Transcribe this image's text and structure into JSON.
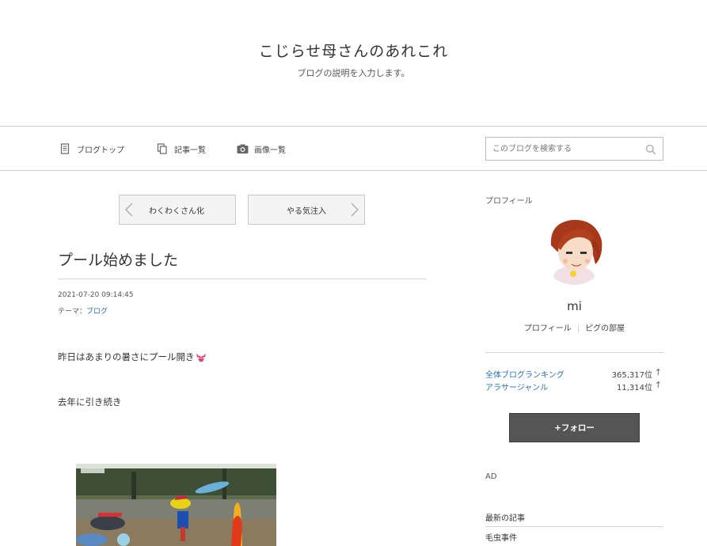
{
  "blog": {
    "title": "こじらせ母さんのあれこれ",
    "description": "ブログの説明を入力します。"
  },
  "nav": {
    "top_label": "ブログトップ",
    "top_icon": "document-icon",
    "list_label": "記事一覧",
    "list_icon": "copy-icon",
    "images_label": "画像一覧",
    "images_icon": "camera-icon"
  },
  "search": {
    "placeholder": "このブログを検索する",
    "value": "",
    "icon": "search-icon"
  },
  "pager": {
    "prev_label": "わくわくさん化",
    "next_label": "やる気注入"
  },
  "entry": {
    "title": "プール始めました",
    "date": "2021-07-20 09:14:45",
    "theme_prefix": "テーマ：",
    "theme": "ブログ",
    "paragraph1": "昨日はあまりの暑さにプール開き",
    "paragraph1_emoji": "bikini-icon",
    "paragraph2": "去年に引き続き"
  },
  "sidebar": {
    "profile_label": "プロフィール",
    "name": "mi",
    "profile_link": "プロフィール",
    "room_link": "ピグの部屋",
    "rankings": [
      {
        "name": "全体ブログランキング",
        "value": "365,317位",
        "arrow": "↑"
      },
      {
        "name": "アラサージャンル",
        "value": "11,314位",
        "arrow": "↑"
      }
    ],
    "follow_label": "+フォロー",
    "ad_label": "AD",
    "latest_label": "最新の記事",
    "latest_items": [
      "毛虫事件"
    ]
  },
  "colors": {
    "link": "#2a6fb8",
    "follow_bg": "#555555",
    "border": "#cfcfcf"
  }
}
